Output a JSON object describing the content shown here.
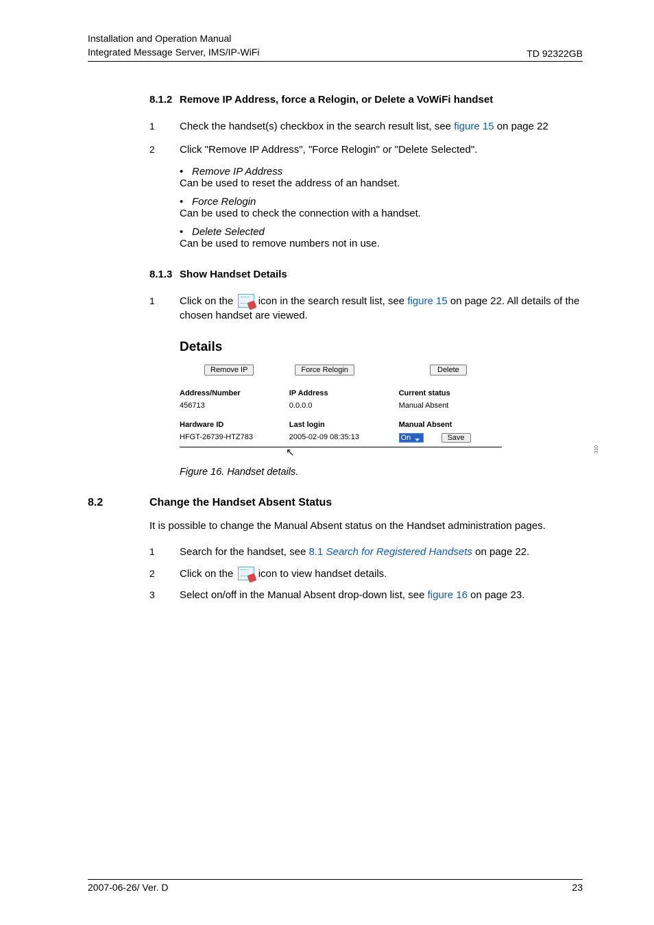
{
  "header": {
    "line1": "Installation and Operation Manual",
    "line2": "Integrated Message Server, IMS/IP-WiFi",
    "right": "TD 92322GB"
  },
  "section_812": {
    "num": "8.1.2",
    "title": "Remove IP Address, force a Relogin, or Delete a VoWiFi handset",
    "step1": {
      "num": "1",
      "text_a": "Check the handset(s) checkbox in the search result list, see ",
      "link": "figure 15",
      "text_b": " on page 22"
    },
    "step2": {
      "num": "2",
      "text": "Click \"Remove IP Address\", \"Force Relogin\" or \"Delete Selected\".",
      "bullets": [
        {
          "title": "Remove IP Address",
          "desc": "Can be used to reset the address of an handset."
        },
        {
          "title": "Force Relogin",
          "desc": "Can be used to check the connection with a handset."
        },
        {
          "title": "Delete Selected",
          "desc": "Can be used to remove numbers not in use."
        }
      ]
    }
  },
  "section_813": {
    "num": "8.1.3",
    "title": "Show Handset Details",
    "step1": {
      "num": "1",
      "text_a": "Click on the ",
      "text_b": " icon in the search result list, see ",
      "link": "figure 15",
      "text_c": " on page 22. All details of the chosen handset are viewed."
    }
  },
  "figure16": {
    "title": "Details",
    "btn_remove": "Remove IP",
    "btn_force": "Force Relogin",
    "btn_delete": "Delete",
    "c1_label": "Address/Number",
    "c1_value": "456713",
    "c2_label": "IP Address",
    "c2_value": "0.0.0.0",
    "c3_label": "Current status",
    "c3_value": "Manual Absent",
    "r2_c1_label": "Hardware ID",
    "r2_c1_value": "HFGT-26739-HTZ783",
    "r2_c2_label": "Last login",
    "r2_c2_value": "2005-02-09 08:35:13",
    "r2_c3_label": "Manual Absent",
    "r2_c3_select": "On",
    "btn_save": "Save",
    "side": "310",
    "caption": "Figure 16. Handset details."
  },
  "section_82": {
    "num": "8.2",
    "title": "Change the Handset Absent Status",
    "intro": "It is possible to change the Manual Absent status on the Handset administration pages.",
    "step1": {
      "num": "1",
      "a": "Search for the handset, see ",
      "link": "8.1 ",
      "link_ital": "Search for Registered Handsets",
      "b": " on page 22."
    },
    "step2": {
      "num": "2",
      "a": "Click on the ",
      "b": " icon to view handset details."
    },
    "step3": {
      "num": "3",
      "a": "Select on/off in the Manual Absent drop-down list, see ",
      "link": "figure 16",
      "b": " on page 23."
    }
  },
  "footer": {
    "left": "2007-06-26/ Ver. D",
    "right": "23"
  }
}
